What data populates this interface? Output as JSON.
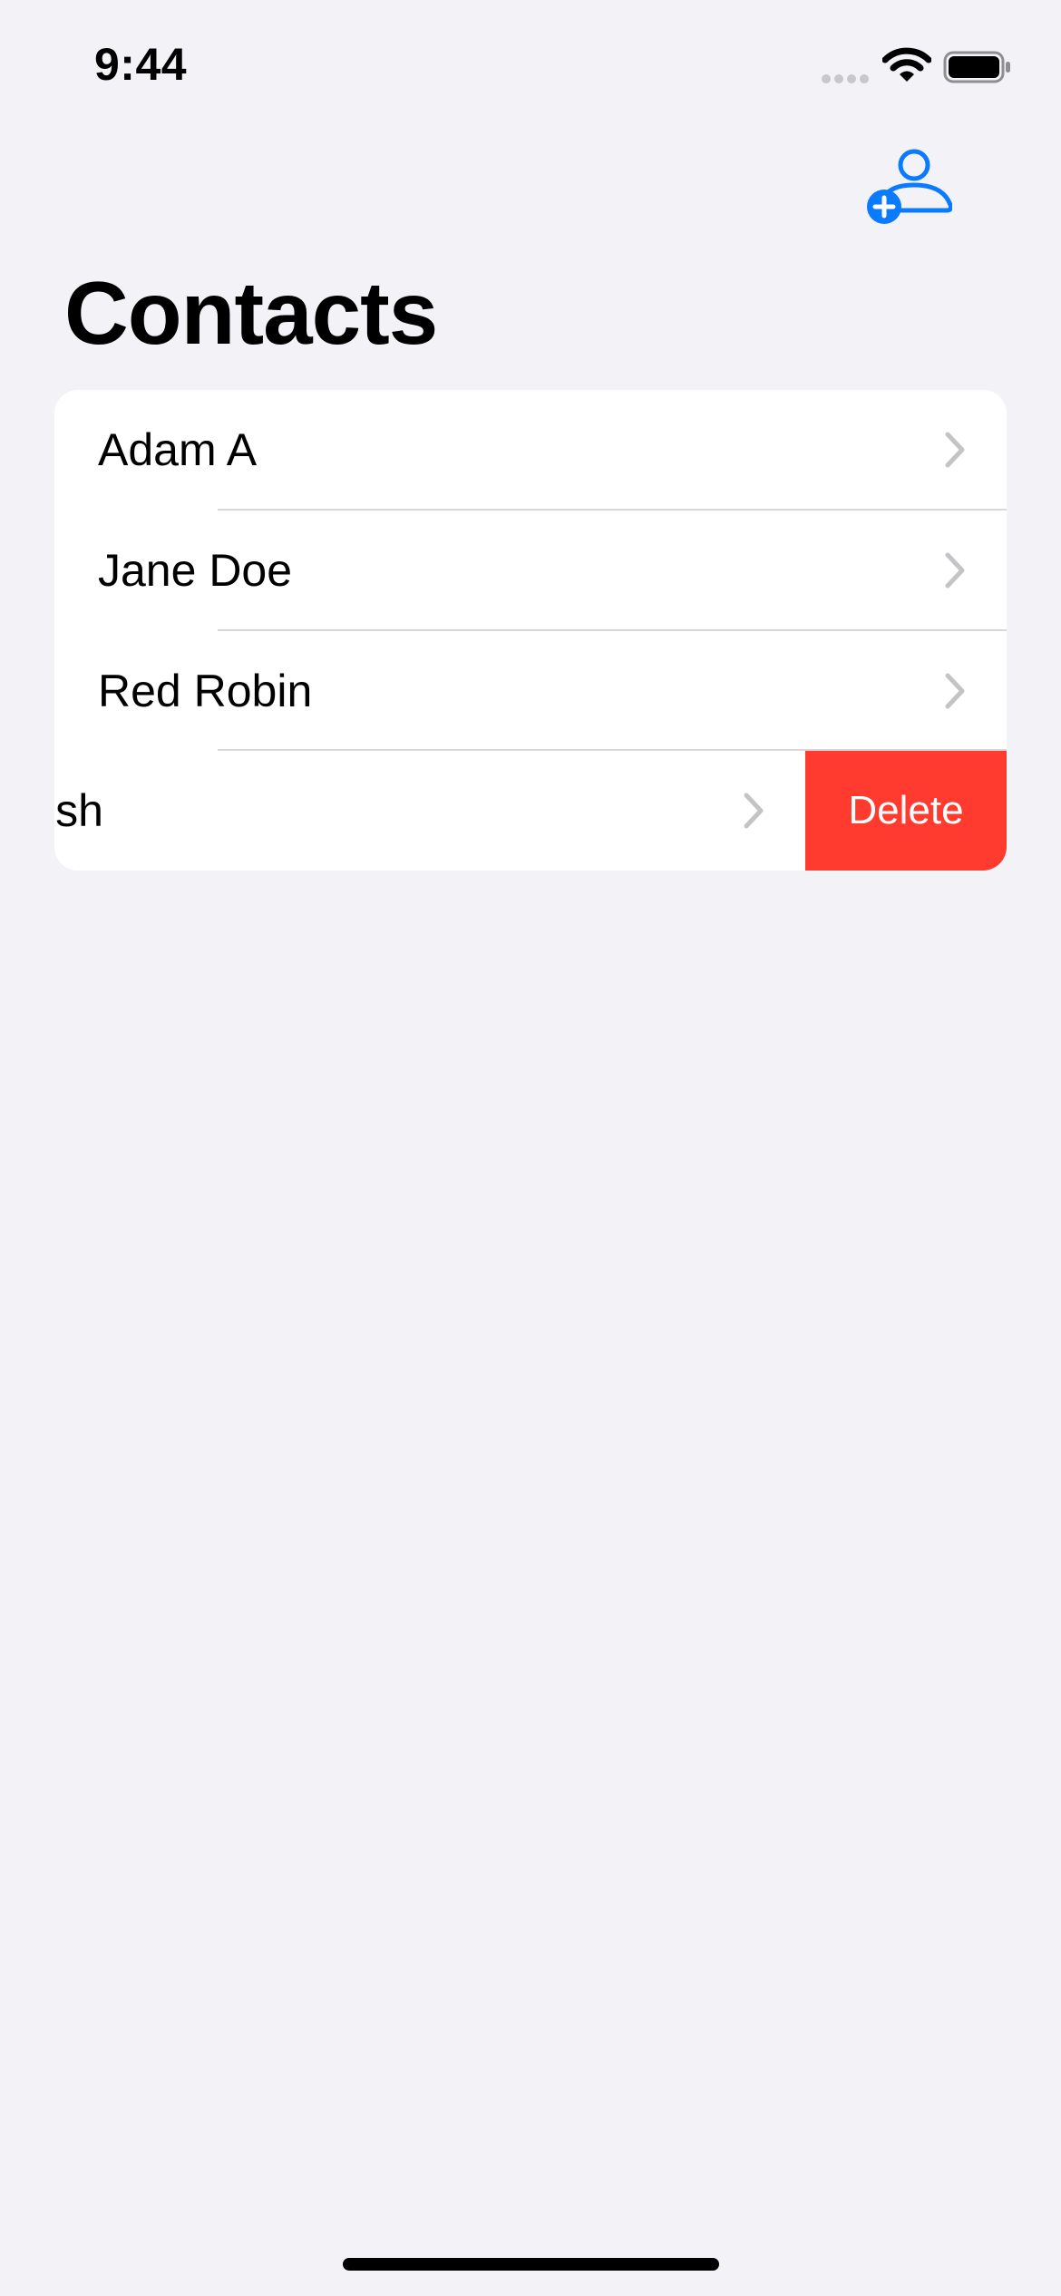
{
  "status_bar": {
    "time": "9:44",
    "wifi_icon": "wifi-icon",
    "battery_icon": "battery-full-icon",
    "signal_icon": "cellular-signal-icon"
  },
  "nav": {
    "add_icon": "person-add-icon",
    "title": "Contacts"
  },
  "contacts": [
    {
      "name": "Adam A"
    },
    {
      "name": "Jane Doe"
    },
    {
      "name": "Red Robin"
    },
    {
      "name": "acintosh",
      "swiped": true,
      "delete_label": "Delete"
    }
  ],
  "colors": {
    "accent": "#0A7AFF",
    "delete": "#FF3B30",
    "background": "#F2F2F7",
    "chevron": "#C4C4C7"
  }
}
